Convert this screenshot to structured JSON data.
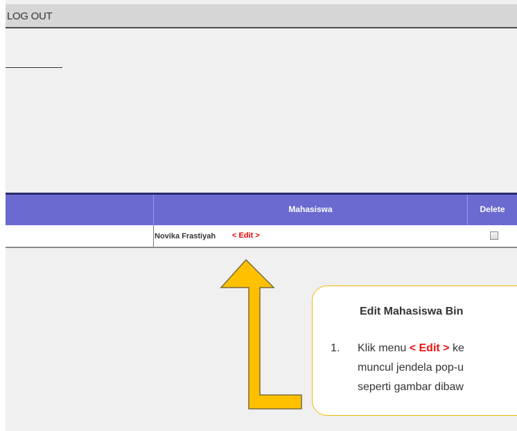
{
  "header": {
    "logout_label": "LOG OUT"
  },
  "grid": {
    "columns": [
      "",
      "Mahasiswa",
      "Delete"
    ],
    "rows": [
      {
        "mahasiswa": "Novika Frastiyah",
        "edit_label": "< Edit >",
        "delete_checked": false
      }
    ]
  },
  "callout": {
    "title": "Edit Mahasiswa Bin",
    "step_number": "1.",
    "line1_prefix": "Klik menu ",
    "line1_highlight": "< Edit >",
    "line1_suffix": " ke",
    "line2": "muncul jendela pop-u",
    "line3": "seperti gambar dibaw"
  },
  "colors": {
    "header_bg": "#d6d6d6",
    "grid_header_bg": "#6a6ad0",
    "edit_red": "#ee0000",
    "arrow_fill": "#ffc000",
    "arrow_stroke": "#7a6a3a",
    "callout_border": "#f5b800"
  },
  "icons": {
    "pointer": "up-arrow-icon",
    "checkbox": "checkbox-icon"
  }
}
